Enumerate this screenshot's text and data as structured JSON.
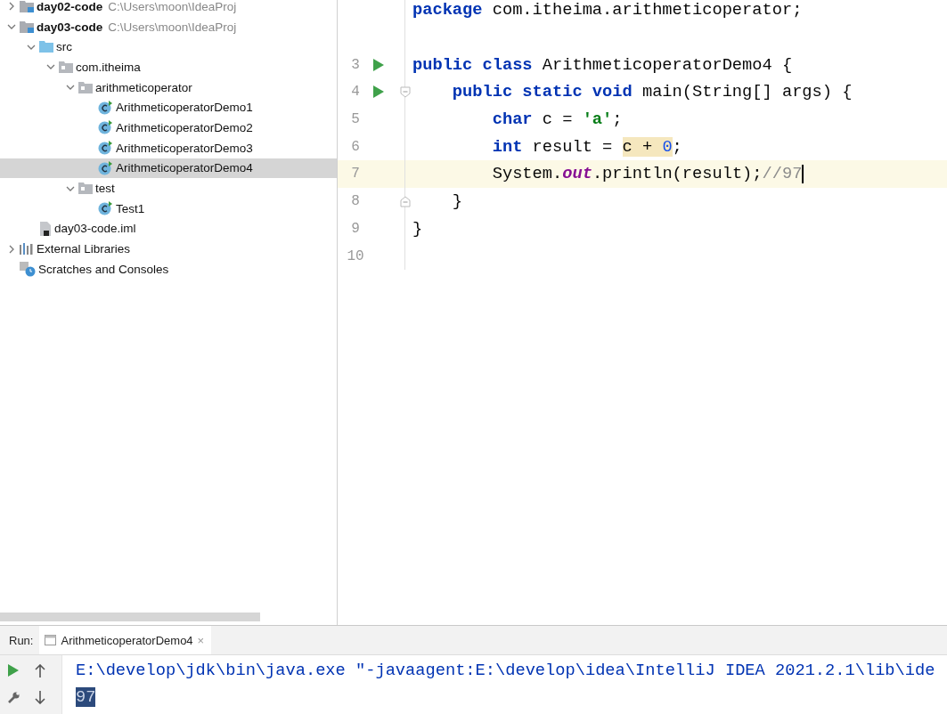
{
  "project_tree": {
    "items": [
      {
        "label": "day02-code",
        "path": "C:\\Users\\moon\\IdeaProj",
        "kind": "module",
        "expanded": false,
        "selected": false
      },
      {
        "label": "day03-code",
        "path": "C:\\Users\\moon\\IdeaProj",
        "kind": "module",
        "expanded": true,
        "selected": false,
        "children": [
          {
            "label": "src",
            "kind": "source",
            "expanded": true,
            "selected": false,
            "children": [
              {
                "label": "com.itheima",
                "kind": "package",
                "expanded": true,
                "selected": false,
                "children": [
                  {
                    "label": "arithmeticoperator",
                    "kind": "package",
                    "expanded": true,
                    "selected": false,
                    "children": [
                      {
                        "label": "ArithmeticoperatorDemo1",
                        "kind": "class",
                        "selected": false
                      },
                      {
                        "label": "ArithmeticoperatorDemo2",
                        "kind": "class",
                        "selected": false
                      },
                      {
                        "label": "ArithmeticoperatorDemo3",
                        "kind": "class",
                        "selected": false
                      },
                      {
                        "label": "ArithmeticoperatorDemo4",
                        "kind": "class",
                        "selected": true
                      }
                    ]
                  },
                  {
                    "label": "test",
                    "kind": "package",
                    "expanded": true,
                    "selected": false,
                    "children": [
                      {
                        "label": "Test1",
                        "kind": "class",
                        "selected": false
                      }
                    ]
                  }
                ]
              }
            ]
          },
          {
            "label": "day03-code.iml",
            "kind": "file",
            "selected": false
          }
        ]
      },
      {
        "label": "External Libraries",
        "kind": "libraries",
        "expanded": false,
        "selected": false
      },
      {
        "label": "Scratches and Consoles",
        "kind": "scratches",
        "selected": false
      }
    ]
  },
  "editor": {
    "lines": [
      {
        "run": false,
        "fold_open": false,
        "fold_close": false,
        "current": false,
        "tokens": [
          {
            "text": "package",
            "kind": "keyword"
          },
          {
            "text": " com.itheima.arithmeticoperator;",
            "kind": "plain"
          }
        ]
      },
      {
        "run": false,
        "fold_open": false,
        "fold_close": false,
        "current": false
      },
      {
        "number": "3",
        "run": true,
        "fold_open": false,
        "fold_close": false,
        "current": false,
        "tokens": [
          {
            "text": "public class",
            "kind": "keyword"
          },
          {
            "text": " ArithmeticoperatorDemo4 {",
            "kind": "plain"
          }
        ]
      },
      {
        "number": "4",
        "run": true,
        "fold_open": true,
        "fold_close": false,
        "current": false,
        "tokens": [
          {
            "text": "    public static void",
            "kind": "keyword"
          },
          {
            "text": " main(String[] args) {",
            "kind": "plain"
          }
        ]
      },
      {
        "number": "5",
        "run": false,
        "fold_open": false,
        "fold_close": false,
        "current": false,
        "tokens": [
          {
            "text": "        char",
            "kind": "keyword"
          },
          {
            "text": " c = ",
            "kind": "plain"
          },
          {
            "text": "'a'",
            "kind": "string"
          },
          {
            "text": ";",
            "kind": "plain"
          }
        ]
      },
      {
        "number": "6",
        "run": false,
        "fold_open": false,
        "fold_close": false,
        "current": false,
        "tokens": [
          {
            "text": "        int",
            "kind": "keyword"
          },
          {
            "text": " result = ",
            "kind": "plain"
          },
          {
            "text": "c + ",
            "kind": "plain",
            "highlighted": true
          },
          {
            "text": "0",
            "kind": "number",
            "highlighted": true
          },
          {
            "text": ";",
            "kind": "plain"
          }
        ]
      },
      {
        "number": "7",
        "run": false,
        "fold_open": false,
        "fold_close": false,
        "current": true,
        "tokens": [
          {
            "text": "        System.",
            "kind": "plain"
          },
          {
            "text": "out",
            "kind": "static"
          },
          {
            "text": ".println(result);",
            "kind": "plain"
          },
          {
            "text": "//97",
            "kind": "comment"
          }
        ]
      },
      {
        "number": "8",
        "run": false,
        "fold_open": false,
        "fold_close": true,
        "current": false,
        "tokens": [
          {
            "text": "    }",
            "kind": "plain"
          }
        ]
      },
      {
        "number": "9",
        "run": false,
        "fold_open": false,
        "fold_close": false,
        "current": false,
        "tokens": [
          {
            "text": "}",
            "kind": "plain"
          }
        ]
      },
      {
        "number": "10",
        "run": false,
        "fold_open": false,
        "fold_close": false,
        "current": false
      }
    ]
  },
  "run_panel": {
    "label": "Run:",
    "tab": {
      "title": "ArithmeticoperatorDemo4",
      "close": "×",
      "selected": true
    },
    "console": [
      {
        "text": "E:\\develop\\jdk\\bin\\java.exe \"-javaagent:E:\\develop\\idea\\IntelliJ IDEA 2021.2.1\\lib\\ide",
        "kind": "command",
        "selected": false
      },
      {
        "text": "97",
        "kind": "output",
        "selected": true
      }
    ]
  }
}
